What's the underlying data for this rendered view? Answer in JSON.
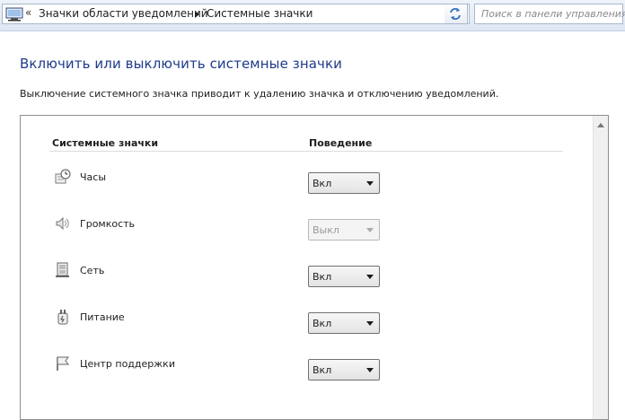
{
  "address_bar": {
    "chevron": "«",
    "breadcrumbs": [
      "Значки области уведомлений",
      "Системные значки"
    ],
    "search_placeholder": "Поиск в панели управления"
  },
  "main": {
    "title": "Включить или выключить системные значки",
    "description": "Выключение системного значка приводит к удалению значка и отключению уведомлений.",
    "columns": {
      "icons": "Системные значки",
      "behavior": "Поведение"
    },
    "rows": [
      {
        "label": "Часы",
        "icon": "clock-icon",
        "value": "Вкл",
        "enabled": true
      },
      {
        "label": "Громкость",
        "icon": "volume-icon",
        "value": "Выкл",
        "enabled": false
      },
      {
        "label": "Сеть",
        "icon": "network-icon",
        "value": "Вкл",
        "enabled": true
      },
      {
        "label": "Питание",
        "icon": "power-icon",
        "value": "Вкл",
        "enabled": true
      },
      {
        "label": "Центр поддержки",
        "icon": "action-center-flag-icon",
        "value": "Вкл",
        "enabled": true
      }
    ]
  },
  "colors": {
    "title": "#1e3a8a",
    "toolbar_top": "#eef3fa",
    "toolbar_bottom": "#dde7f3",
    "panel_border": "#8e8e8e"
  }
}
